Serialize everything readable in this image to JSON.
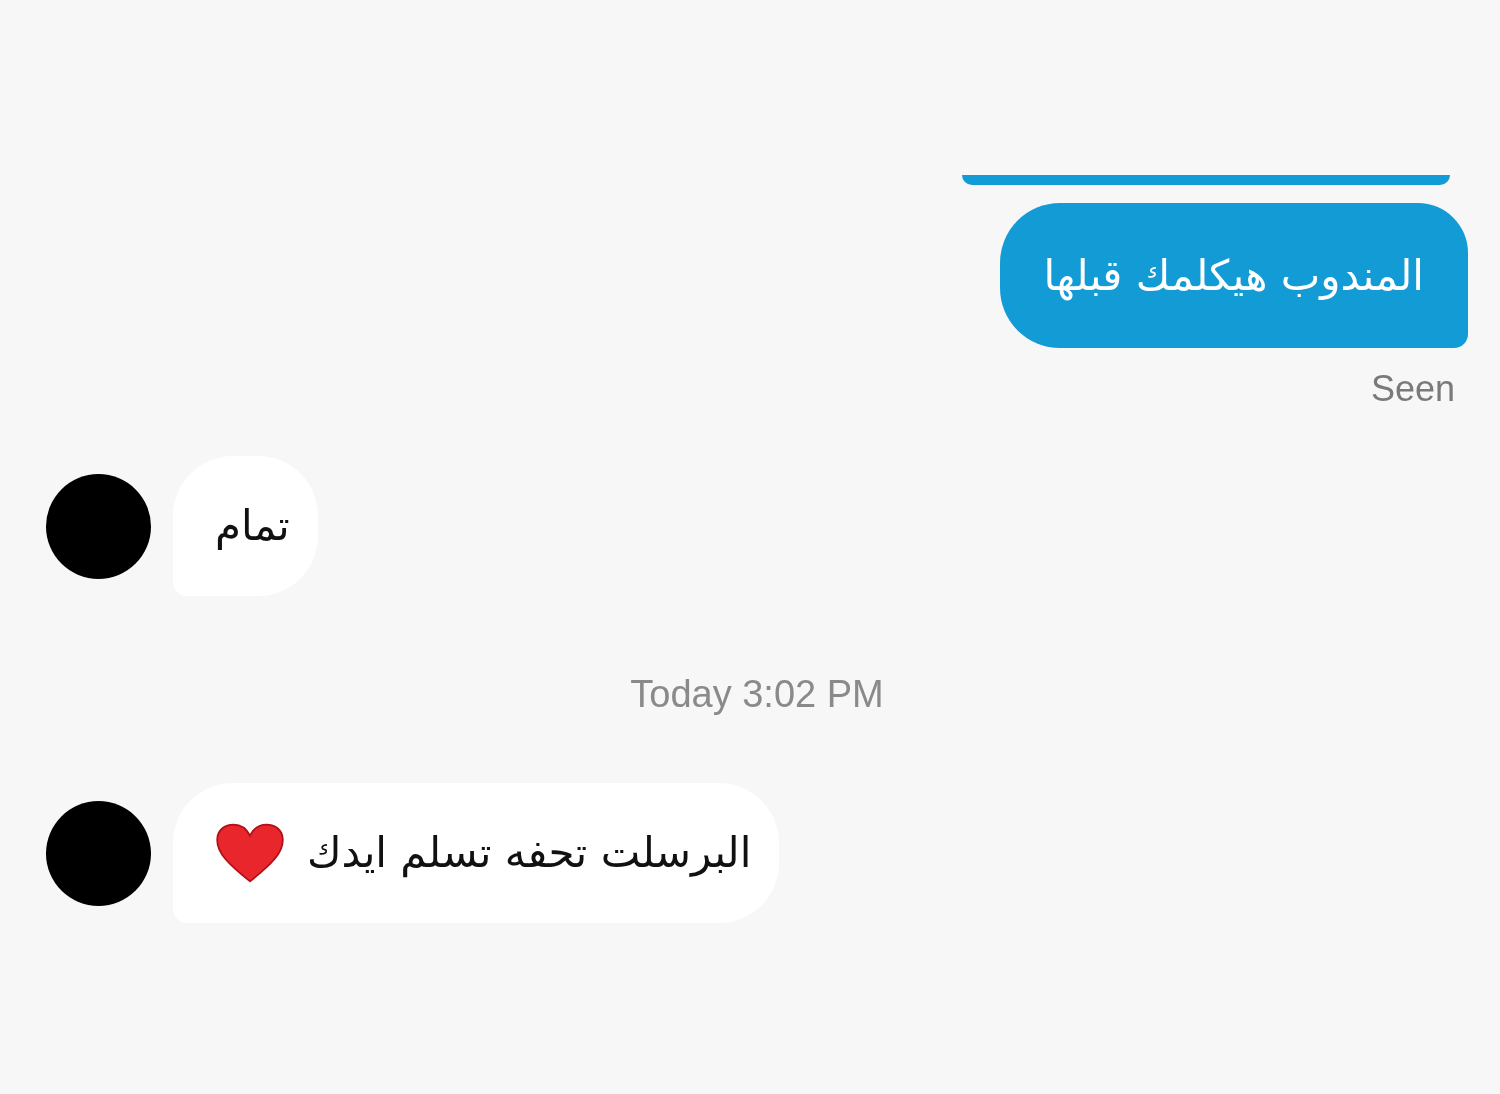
{
  "messages": [
    {
      "kind": "sent-clipped"
    },
    {
      "kind": "sent",
      "text": "المندوب هيكلمك قبلها"
    },
    {
      "kind": "status",
      "text": "Seen"
    },
    {
      "kind": "received",
      "text": "تمام",
      "heart": false
    },
    {
      "kind": "timestamp",
      "text": "Today 3:02 PM"
    },
    {
      "kind": "received",
      "text": "البرسلت تحفه تسلم ايدك",
      "heart": true
    }
  ]
}
